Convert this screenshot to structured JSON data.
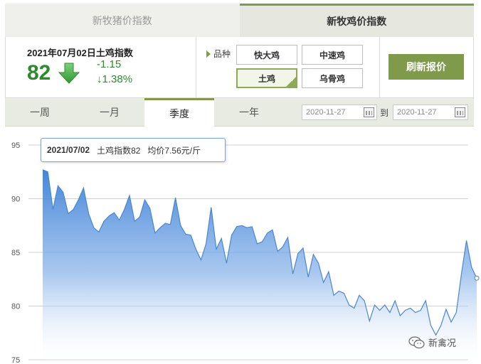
{
  "tabs": {
    "pig": "新牧猪价指数",
    "chicken": "新牧鸡价指数"
  },
  "index": {
    "title": "2021年07月02日土鸡指数",
    "value": "82",
    "change": "-1.15",
    "pct": "↓1.38%"
  },
  "variety": {
    "label": "品种",
    "options": [
      "快大鸡",
      "中速鸡",
      "土鸡",
      "乌骨鸡"
    ],
    "selected": "土鸡"
  },
  "refresh_label": "刷新报价",
  "periods": [
    "一周",
    "一月",
    "季度",
    "一年"
  ],
  "active_period": "季度",
  "date_range": {
    "from": "2020-11-27",
    "to_label": "到",
    "to": "2020-11-27"
  },
  "tooltip": {
    "date": "2021/07/02",
    "index_text": "土鸡指数82",
    "avg_text": "均价7.56元/斤"
  },
  "watermark": "新禽况",
  "colors": {
    "accent": "#7f9a4a",
    "up_down": "#2d8a2d",
    "line": "#4a86d0"
  },
  "chart_data": {
    "type": "area",
    "ylim": [
      75,
      95
    ],
    "yticks": [
      95,
      90,
      85,
      80,
      75
    ],
    "grid": true,
    "values": [
      92.7,
      92.5,
      89,
      91.2,
      90.6,
      88.6,
      89,
      89.9,
      91,
      88.6,
      87.3,
      86.9,
      87.9,
      88.4,
      88.7,
      88,
      89,
      90.3,
      87.9,
      88.3,
      89.9,
      89.1,
      86.8,
      87.3,
      87.7,
      87.6,
      90.1,
      87.5,
      86.7,
      86.6,
      85.3,
      84.3,
      85.8,
      89.2,
      85.3,
      86.3,
      84,
      86.6,
      87.4,
      87.5,
      87.3,
      87.4,
      85.8,
      86,
      86.8,
      87.1,
      85.1,
      85.5,
      86.4,
      83,
      84.9,
      85.4,
      82.7,
      84.8,
      84,
      82.2,
      83.2,
      81,
      81.4,
      81.2,
      80.1,
      79.8,
      81,
      80.5,
      78.6,
      80.1,
      79.6,
      80.1,
      79.4,
      80.5,
      79.1,
      79.6,
      79.8,
      79.4,
      79.6,
      80.5,
      78.2,
      77.3,
      78.2,
      79.7,
      78.5,
      79.4,
      83,
      86.1,
      83.6,
      82.6
    ]
  }
}
